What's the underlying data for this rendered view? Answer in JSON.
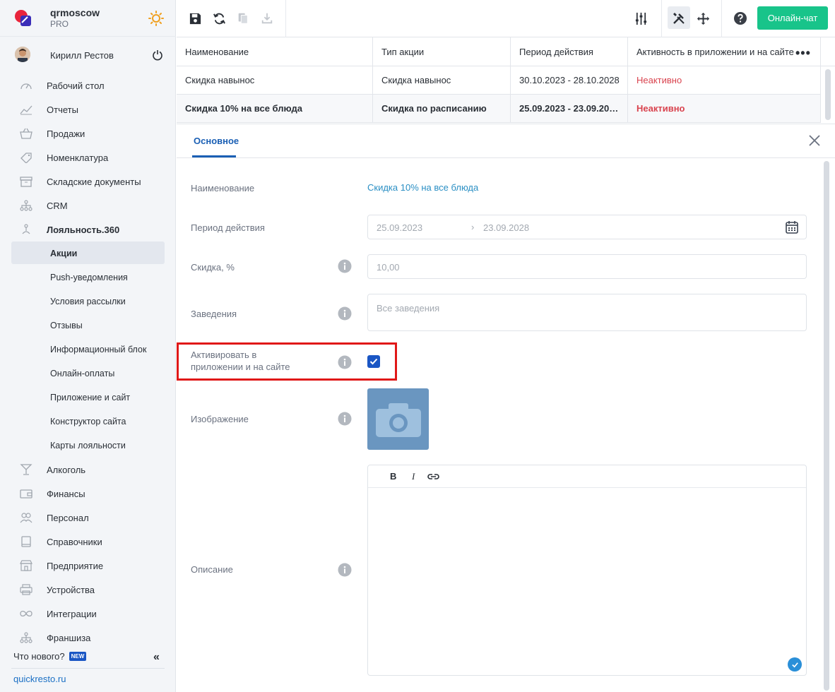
{
  "brand": {
    "name": "qrmoscow",
    "plan": "PRO"
  },
  "user": {
    "name": "Кирилл Рестов"
  },
  "nav": {
    "items": [
      {
        "label": "Рабочий стол",
        "icon": "speedometer-icon"
      },
      {
        "label": "Отчеты",
        "icon": "chart-icon"
      },
      {
        "label": "Продажи",
        "icon": "basket-icon"
      },
      {
        "label": "Номенклатура",
        "icon": "tag-icon"
      },
      {
        "label": "Складские документы",
        "icon": "archive-icon"
      },
      {
        "label": "CRM",
        "icon": "network-icon"
      },
      {
        "label": "Лояльность.360",
        "icon": "loyalty-icon"
      }
    ],
    "sub": [
      "Акции",
      "Push-уведомления",
      "Условия рассылки",
      "Отзывы",
      "Информационный блок",
      "Онлайн-оплаты",
      "Приложение и сайт",
      "Конструктор сайта",
      "Карты лояльности"
    ],
    "items2": [
      {
        "label": "Алкоголь",
        "icon": "cocktail-icon"
      },
      {
        "label": "Финансы",
        "icon": "wallet-icon"
      },
      {
        "label": "Персонал",
        "icon": "people-icon"
      },
      {
        "label": "Справочники",
        "icon": "book-icon"
      },
      {
        "label": "Предприятие",
        "icon": "store-icon"
      },
      {
        "label": "Устройства",
        "icon": "printer-icon"
      },
      {
        "label": "Интеграции",
        "icon": "infinity-icon"
      },
      {
        "label": "Франшиза",
        "icon": "network-icon"
      }
    ]
  },
  "footer": {
    "whats_new": "Что нового?",
    "new_badge": "NEW",
    "site": "quickresto.ru"
  },
  "toolbar": {
    "chat_label": "Онлайн-чат"
  },
  "table": {
    "headers": [
      "Наименование",
      "Тип акции",
      "Период действия",
      "Активность в приложении и на сайте"
    ],
    "rows": [
      [
        "Скидка навынос",
        "Скидка навынос",
        "30.10.2023 - 28.10.2028",
        "Неактивно"
      ],
      [
        "Скидка 10% на все блюда",
        "Скидка по расписанию",
        "25.09.2023 - 23.09.20…",
        "Неактивно"
      ]
    ]
  },
  "panel": {
    "tab": "Основное",
    "fields": {
      "name_label": "Наименование",
      "name_value": "Скидка 10% на все блюда",
      "period_label": "Период действия",
      "period_from": "25.09.2023",
      "period_to": "23.09.2028",
      "discount_label": "Скидка, %",
      "discount_value": "10,00",
      "venues_label": "Заведения",
      "venues_placeholder": "Все заведения",
      "activate_label": "Активировать в приложении и на сайте",
      "activate_checked": true,
      "image_label": "Изображение",
      "description_label": "Описание"
    },
    "editor": {
      "bold": "B",
      "italic": "I"
    }
  }
}
